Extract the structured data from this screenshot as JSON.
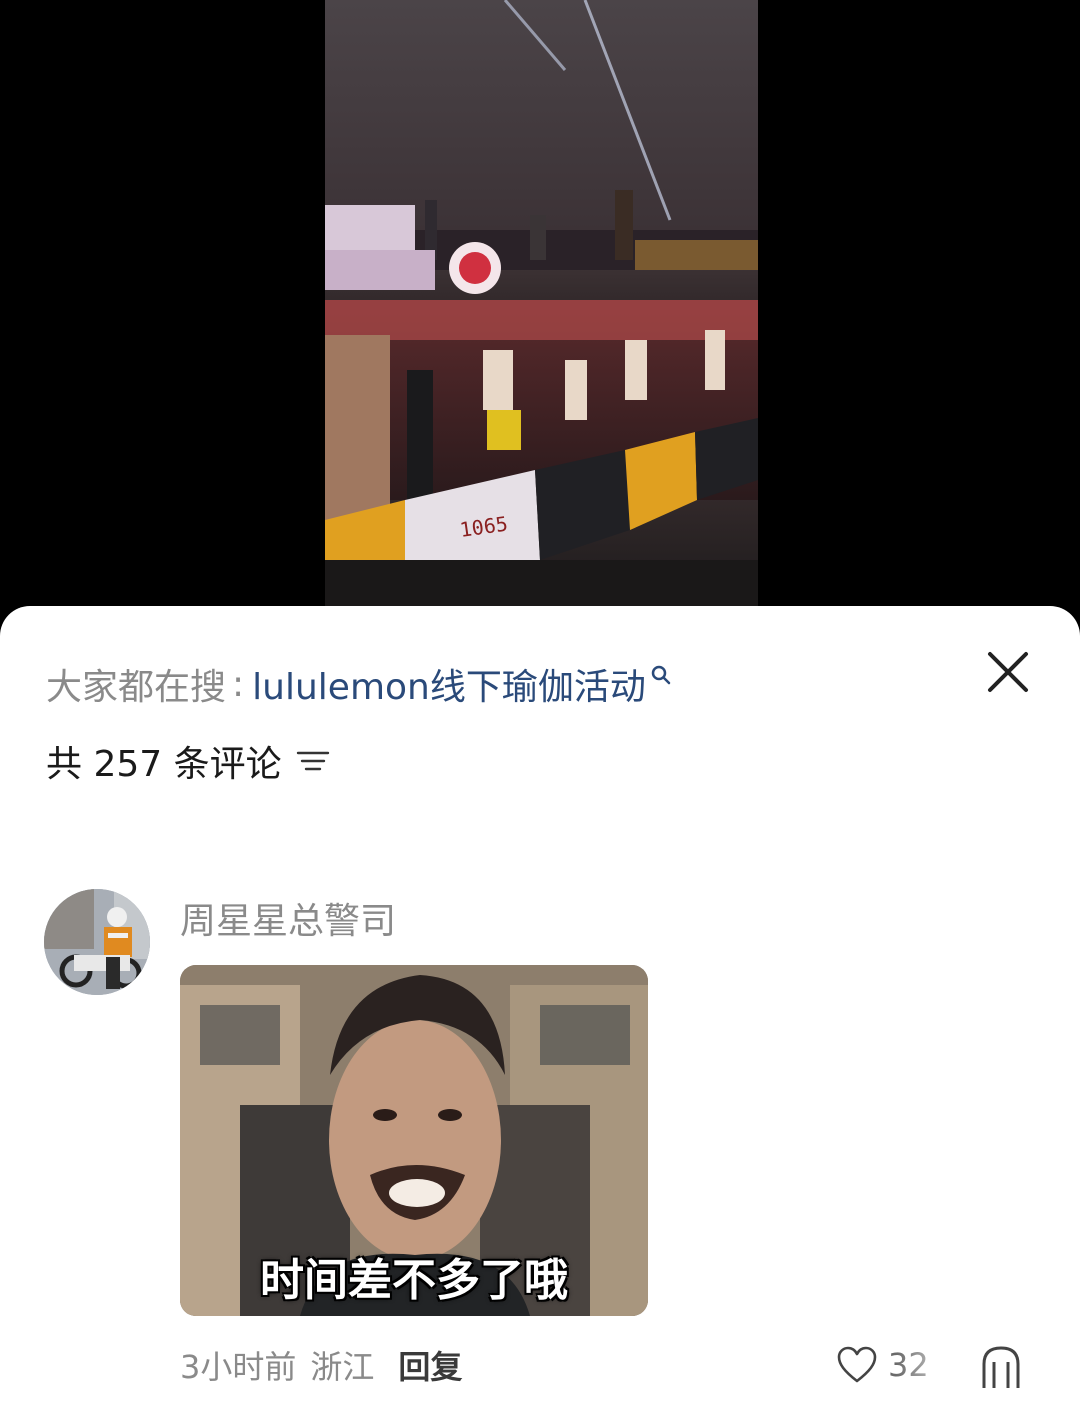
{
  "search": {
    "prefix": "大家都在搜",
    "separator": ":",
    "term": "lululemon线下瑜伽活动",
    "icon": "search-icon"
  },
  "header": {
    "comment_count": "共 257 条评论",
    "sort_icon": "filter-icon",
    "close_icon": "close-icon"
  },
  "comment": {
    "username": "周星星总警司",
    "sticker_caption": "时间差不多了哦",
    "time": "3小时前",
    "location": "浙江",
    "reply_label": "回复",
    "likes": "32"
  },
  "video": {
    "sign_number": "1065"
  },
  "colors": {
    "search_term": "#2a4a7a",
    "muted": "#8a8a8a",
    "text": "#1a1a1a"
  }
}
